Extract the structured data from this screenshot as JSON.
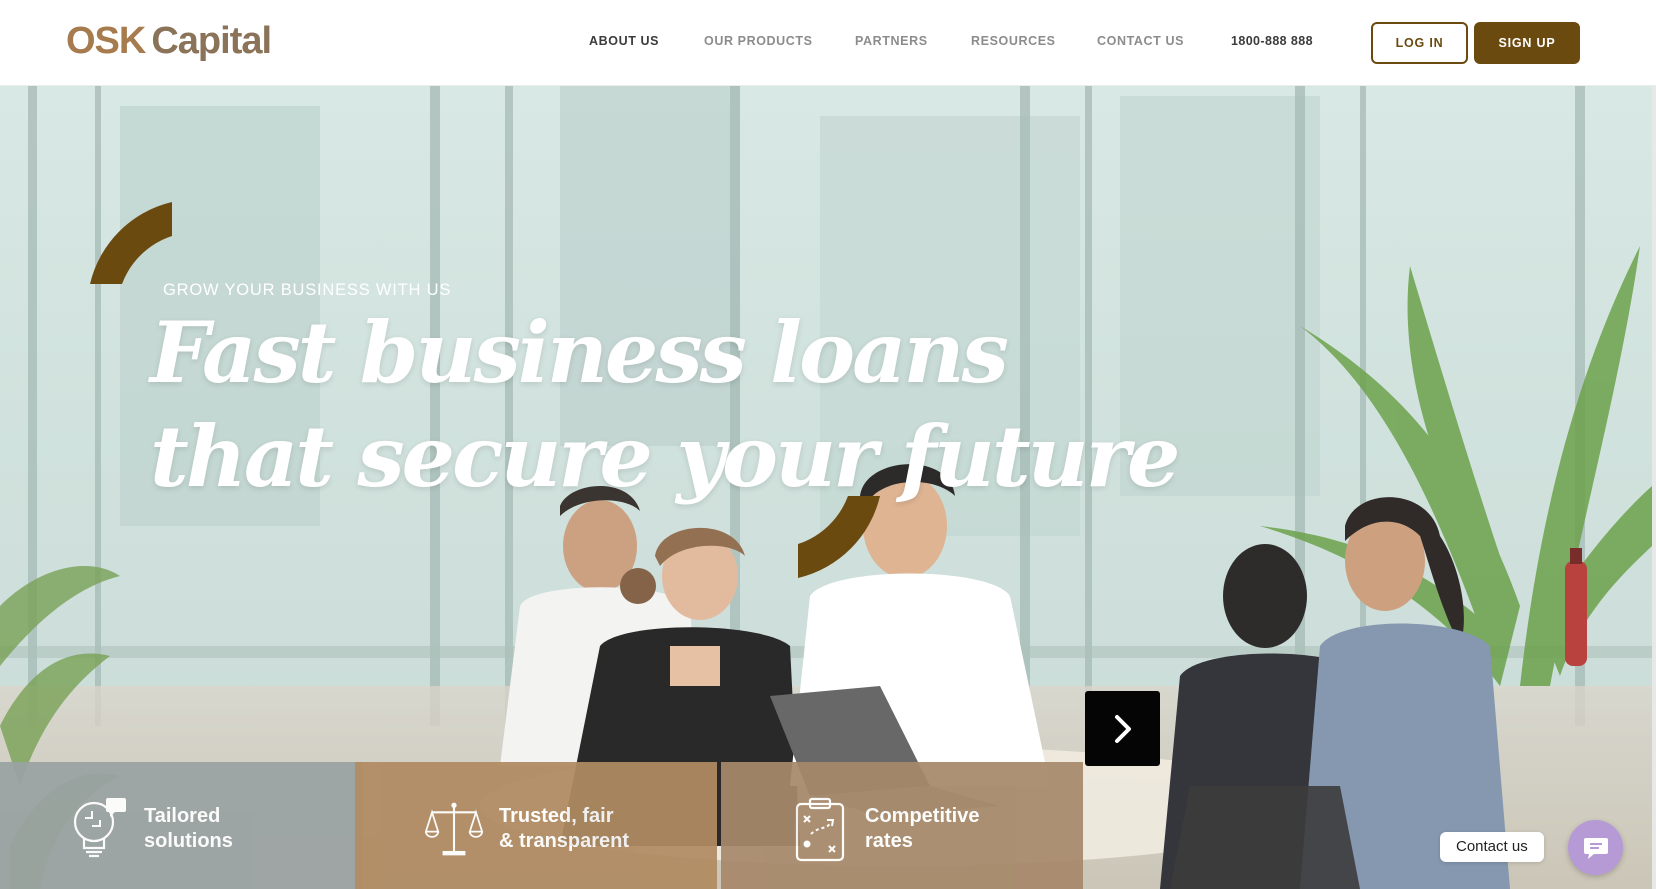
{
  "brand": {
    "logo_part1": "OSK",
    "logo_part2": "Capital",
    "primary_color": "#6b4a10",
    "accent_color": "#a67c4f"
  },
  "nav": {
    "items": [
      {
        "label": "ABOUT US",
        "active": true
      },
      {
        "label": "OUR PRODUCTS",
        "active": false
      },
      {
        "label": "PARTNERS",
        "active": false
      },
      {
        "label": "RESOURCES",
        "active": false
      },
      {
        "label": "CONTACT US",
        "active": false
      }
    ],
    "phone": "1800-888 888",
    "login_label": "LOG IN",
    "signup_label": "SIGN UP"
  },
  "hero": {
    "eyebrow": "GROW YOUR BUSINESS WITH US",
    "headline_line1": "Fast business loans",
    "headline_line2": "that secure your future",
    "next_icon": "chevron-right-icon"
  },
  "features": [
    {
      "label": "Tailored\nsolutions",
      "icon": "lightbulb-puzzle-icon",
      "bg": "#9aa3a3"
    },
    {
      "label": "Trusted, fair\n& transparent",
      "icon": "scales-icon",
      "bg": "#b08b62"
    },
    {
      "label": "Competitive\nrates",
      "icon": "clipboard-strategy-icon",
      "bg": "#a7896a"
    }
  ],
  "contact_widget": {
    "label": "Contact us",
    "icon": "chat-icon",
    "color": "#b59ad6"
  }
}
